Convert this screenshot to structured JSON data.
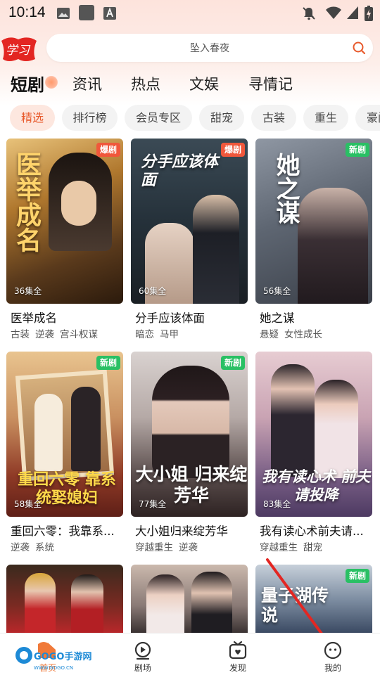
{
  "status_bar": {
    "time": "10:14"
  },
  "search": {
    "placeholder": "坠入春夜"
  },
  "main_tabs": [
    {
      "label": "短剧",
      "active": true
    },
    {
      "label": "资讯"
    },
    {
      "label": "热点"
    },
    {
      "label": "文娱"
    },
    {
      "label": "寻情记"
    }
  ],
  "chips": [
    {
      "label": "精选",
      "active": true
    },
    {
      "label": "排行榜"
    },
    {
      "label": "会员专区"
    },
    {
      "label": "甜宠"
    },
    {
      "label": "古装"
    },
    {
      "label": "重生"
    },
    {
      "label": "豪门"
    }
  ],
  "cards": [
    {
      "title": "医举成名",
      "episodes": "36集全",
      "badge": "爆剧",
      "badge_type": "hot",
      "tags": [
        "古装",
        "逆袭",
        "宫斗权谋"
      ],
      "poster_text": "医举成名"
    },
    {
      "title": "分手应该体面",
      "episodes": "60集全",
      "badge": "爆剧",
      "badge_type": "hot",
      "tags": [
        "暗恋",
        "马甲"
      ],
      "poster_text": "分手应该体面"
    },
    {
      "title": "她之谋",
      "episodes": "56集全",
      "badge": "新剧",
      "badge_type": "new",
      "tags": [
        "悬疑",
        "女性成长"
      ],
      "poster_text": "她之谋"
    },
    {
      "title": "重回六零：我靠系...",
      "episodes": "58集全",
      "badge": "新剧",
      "badge_type": "new",
      "tags": [
        "逆袭",
        "系统"
      ],
      "poster_text": "重回六零 靠系统娶媳妇"
    },
    {
      "title": "大小姐归来绽芳华",
      "episodes": "77集全",
      "badge": "新剧",
      "badge_type": "new",
      "tags": [
        "穿越重生",
        "逆袭"
      ],
      "poster_text": "大小姐 归来绽芳华"
    },
    {
      "title": "我有读心术前夫请...",
      "episodes": "83集全",
      "badge": "",
      "badge_type": "",
      "tags": [
        "穿越重生",
        "甜宠"
      ],
      "poster_text": "我有读心术 前夫请投降"
    },
    {
      "title": "",
      "episodes": "",
      "badge": "",
      "badge_type": "",
      "tags": [],
      "poster_text": ""
    },
    {
      "title": "",
      "episodes": "",
      "badge": "",
      "badge_type": "",
      "tags": [],
      "poster_text": ""
    },
    {
      "title": "",
      "episodes": "",
      "badge": "新剧",
      "badge_type": "new",
      "tags": [],
      "poster_text": "量子湖传说"
    }
  ],
  "bottom_nav": [
    {
      "label": "首页",
      "icon": "home-icon"
    },
    {
      "label": "剧场",
      "icon": "theater-icon"
    },
    {
      "label": "发现",
      "icon": "discover-icon"
    },
    {
      "label": "我的",
      "icon": "profile-icon"
    }
  ],
  "watermark": {
    "text": "GOGO手游网",
    "url_text": "WWW.GOGO.CN"
  },
  "colors": {
    "accent": "#e85a2c",
    "hot_badge": "#f0573b",
    "new_badge": "#29c064"
  }
}
